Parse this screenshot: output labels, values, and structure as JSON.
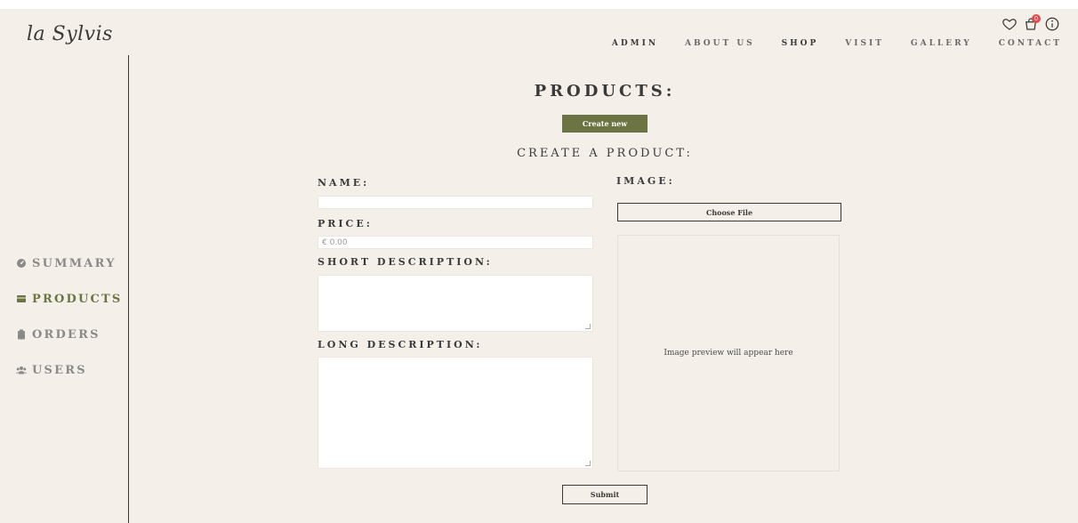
{
  "brand": {
    "logo_text": "la Sylvis"
  },
  "nav": {
    "items": [
      {
        "label": "ADMIN"
      },
      {
        "label": "ABOUT US"
      },
      {
        "label": "SHOP"
      },
      {
        "label": "VISIT"
      },
      {
        "label": "GALLERY"
      },
      {
        "label": "CONTACT"
      }
    ]
  },
  "header_icons": {
    "cart_badge": "0",
    "icons": [
      "heart-icon",
      "cart-icon",
      "info-icon"
    ]
  },
  "sidebar": {
    "items": [
      {
        "label": "SUMMARY",
        "icon": "dashboard-icon",
        "active": false
      },
      {
        "label": "PRODUCTS",
        "icon": "products-icon",
        "active": true
      },
      {
        "label": "ORDERS",
        "icon": "clipboard-icon",
        "active": false
      },
      {
        "label": "USERS",
        "icon": "users-icon",
        "active": false
      }
    ]
  },
  "page": {
    "title": "PRODUCTS:",
    "create_button": "Create new",
    "form_title": "CREATE A PRODUCT:"
  },
  "form": {
    "name_label": "NAME:",
    "name_value": "",
    "price_label": "PRICE:",
    "price_placeholder": "€ 0.00",
    "short_desc_label": "SHORT DESCRIPTION:",
    "long_desc_label": "LONG DESCRIPTION:",
    "image_label": "IMAGE:",
    "choose_file": "Choose File",
    "preview_text": "Image preview will appear here",
    "submit": "Submit"
  },
  "colors": {
    "background": "#f5efe9",
    "accent": "#6b7442",
    "text": "#3a3a3a"
  }
}
